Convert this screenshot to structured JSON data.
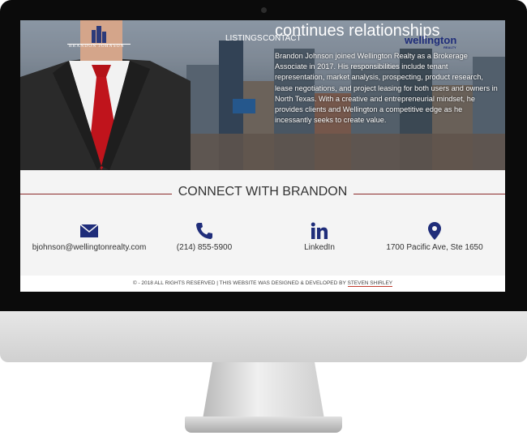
{
  "nav": {
    "listings": "LISTINGS",
    "contact": "CONTACT"
  },
  "logo_left": "BRANDON JOHNSON",
  "logo_right": {
    "name": "wellington",
    "sub": "REALTY"
  },
  "hero": {
    "heading": "continues relationships",
    "paragraph": "Brandon Johnson joined Wellington Realty as a Brokerage Associate in 2017. His responsibilities include tenant representation, market analysis, prospecting, product research, lease negotiations, and project leasing for both users and owners in North Texas. With a creative and entrepreneurial mindset, he provides clients and Wellington a competitive edge as he incessantly seeks to create value."
  },
  "connect": {
    "title": "CONNECT WITH BRANDON",
    "items": [
      {
        "icon": "envelope-icon",
        "label": "bjohnson@wellingtonrealty.com"
      },
      {
        "icon": "phone-icon",
        "label": "(214) 855-5900"
      },
      {
        "icon": "linkedin-icon",
        "label": "LinkedIn"
      },
      {
        "icon": "map-pin-icon",
        "label": "1700 Pacific Ave, Ste 1650"
      }
    ]
  },
  "footer": {
    "text": "© - 2018 ALL RIGHTS RESERVED | THIS WEBSITE WAS DESIGNED & DEVELOPED BY ",
    "link": "STEVEN SHIRLEY"
  },
  "colors": {
    "accent": "#1f2d7a",
    "rule": "#8b2b2b",
    "tie": "#c0141c"
  }
}
